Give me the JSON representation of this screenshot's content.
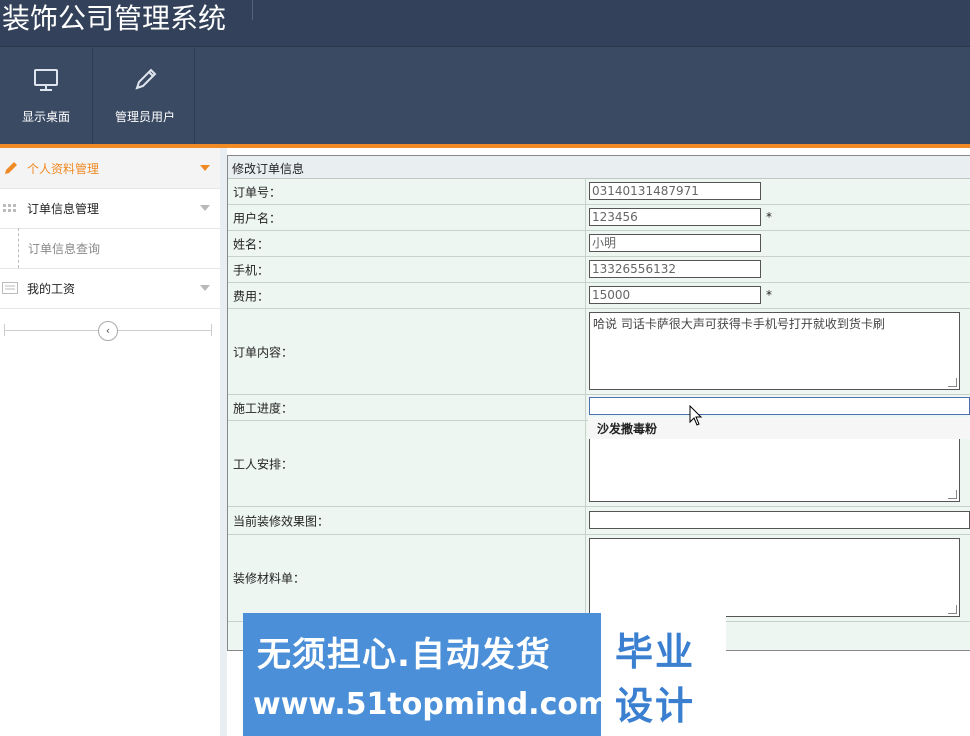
{
  "app": {
    "title": "装饰公司管理系统"
  },
  "toolbar": [
    {
      "label": "显示桌面",
      "icon": "monitor-icon"
    },
    {
      "label": "管理员用户",
      "icon": "pencil-icon"
    }
  ],
  "sidebar": {
    "items": [
      {
        "label": "个人资料管理",
        "icon": "pencil-icon",
        "active": true
      },
      {
        "label": "订单信息管理",
        "icon": "grid-icon"
      },
      {
        "label": "订单信息查询",
        "sub": true
      },
      {
        "label": "我的工资",
        "icon": "keyboard-icon"
      }
    ],
    "collapse_glyph": "‹"
  },
  "form": {
    "title": "修改订单信息",
    "fields": [
      {
        "label": "订单号：",
        "value": "03140131487971"
      },
      {
        "label": "用户名：",
        "value": "123456",
        "required": "*"
      },
      {
        "label": "姓名：",
        "value": "小明"
      },
      {
        "label": "手机：",
        "value": "13326556132"
      },
      {
        "label": "费用：",
        "value": "15000",
        "required": "*"
      },
      {
        "label": "订单内容：",
        "value": "哈说 司话卡萨很大声可获得卡手机号打开就收到货卡刷"
      },
      {
        "label": "施工进度：",
        "value": ""
      },
      {
        "label": "工人安排：",
        "value": ""
      },
      {
        "label": "当前装修效果图：",
        "value": ""
      },
      {
        "label": "装修材料单：",
        "value": ""
      }
    ],
    "autocomplete": "沙发撒毒粉"
  },
  "banner": {
    "line1": "无须担心.自动发货",
    "line2": "www.51topmind.com",
    "box_line1": "毕业",
    "box_line2": "设计"
  }
}
